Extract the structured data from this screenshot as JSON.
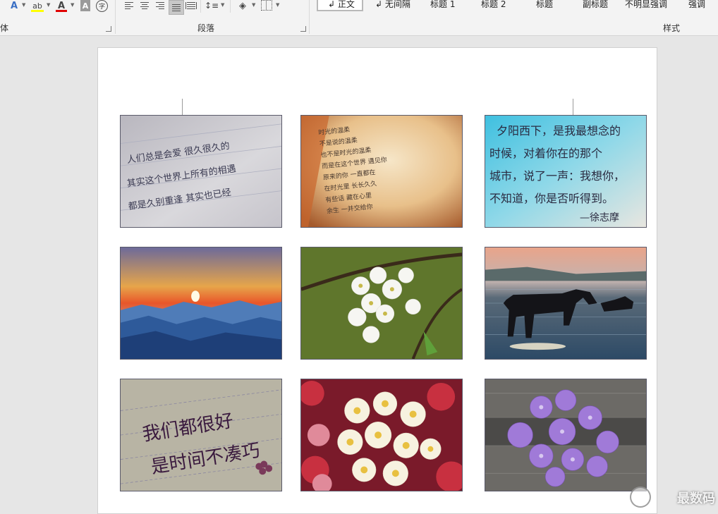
{
  "ribbon": {
    "font_group_label": "体",
    "paragraph_group_label": "段落",
    "styles_group_label": "样式",
    "char_border_glyph": "A",
    "phonetic_glyph": "字",
    "font_color_glyph": "A",
    "styles": [
      {
        "label": "↲ 正文",
        "active": true
      },
      {
        "label": "↲ 无间隔",
        "active": false
      },
      {
        "label": "标题 1",
        "active": false
      },
      {
        "label": "标题 2",
        "active": false
      },
      {
        "label": "标题",
        "active": false
      },
      {
        "label": "副标题",
        "active": false
      },
      {
        "label": "不明显强调",
        "active": false
      },
      {
        "label": "强调",
        "active": false
      }
    ],
    "colors": {
      "highlight": "#ffff00",
      "font_color": "#e00000"
    }
  },
  "document": {
    "photos": [
      {
        "name": "handwriting-note-photo",
        "lines": [
          "人们总是会爱 很久很久的",
          "其实这个世界上所有的相遇",
          "都是久别重逢 其实也已经"
        ]
      },
      {
        "name": "poem-card-photo",
        "lines": [
          "时光的温柔",
          "不是说的温柔",
          "也不是时光的温柔",
          "而是在这个世界 遇见你",
          "原来的你 一直都在",
          "在时光里 长长久久",
          "有些话 藏在心里",
          "余生 一并交给你"
        ]
      },
      {
        "name": "blue-handwriting-photo",
        "lines": [
          "夕阳西下，是我最想念的",
          "时候，对着你在的那个",
          "城市，说了一声：我想你，",
          "不知道，你是否听得到。",
          "—徐志摩"
        ]
      },
      {
        "name": "mountain-sunset-photo"
      },
      {
        "name": "white-blossom-photo"
      },
      {
        "name": "horses-in-water-photo"
      },
      {
        "name": "purple-handwriting-photo",
        "lines": [
          "我们都很好",
          "是时间不凑巧"
        ]
      },
      {
        "name": "daisy-bouquet-photo"
      },
      {
        "name": "purple-hydrangea-photo"
      }
    ],
    "watermark": "最数码"
  }
}
